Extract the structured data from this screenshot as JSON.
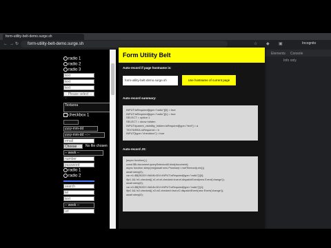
{
  "browser": {
    "tab": "form-utility-belt-demo.surge.sh",
    "url": "form-utility-belt-demo.surge.sh",
    "profile": "Incognito",
    "devtools": {
      "tab1": "⏷",
      "tab2": "Elements",
      "tab3": "Console",
      "filter": "Info only"
    }
  },
  "form": {
    "radio1": "radio 1",
    "radio2": "radio 2",
    "radio3": "radio 3",
    "text": "text",
    "select": "-- Please select -- ˅",
    "textarea_placeholder": "Textarea",
    "checkbox": "checkbox 1",
    "date": "yyyy-mm-dd",
    "datetime": "yyyy-mm-dd --:--",
    "email": "email",
    "choose": "Choose File",
    "nofile": "No file chosen",
    "number": "number",
    "password": "password",
    "search": "search",
    "tel": "tel",
    "url": "url",
    "radioA": "radio 1",
    "radioB": "radio 2",
    "week": "-- week --"
  },
  "panel": {
    "title": "Form Utility Belt",
    "autorecord_label": "Auto-record if page hostname is:",
    "hostname": "form-utility-belt-demo.surge.sh",
    "use_hostname": "Use hostname of current page",
    "summary_label": "Auto-record summary:",
    "summary_lines": [
      "INPUT:isRequired[type=\"radio\"][0] = true",
      "INPUT:isRequired[type=\"radio\"][1] = true",
      "SELECT = option 1",
      "SELECT = show hidden",
      "INPUT#parent_visibility_hidden:isRequired[type=\"text\"] = a",
      "TEXTAREA.isRequired = b",
      "INPUT[type=\"checkbox\"] = true"
    ],
    "js_label": "Auto-record JS:",
    "js_lines": [
      "[async function() {",
      "const $$=document.querySelectorAll.bind(document);",
      "async function sleep(ms){await new Promise(r=>setTimeout(r,ms))}",
      "await sleep(0);",
      "var e1=$$('BODY>MAIN>DIV>INPUT.isRequired[type=\"radio\"]')[0];",
      "if(e1 && !e1.checked){ e1.el=el.checked=true;el.dispatchEvent(new Event('change'));",
      "await sleep(0);",
      "var e2=$$('BODY>MAIN>DIV>INPUT.isRequired[type=\"radio\"]')[1];",
      "if(e2 && !e2.checked){ e2=e2.checked=true;e2.dispatchEvent(new Event('change'));",
      "await sleep(0);"
    ]
  }
}
